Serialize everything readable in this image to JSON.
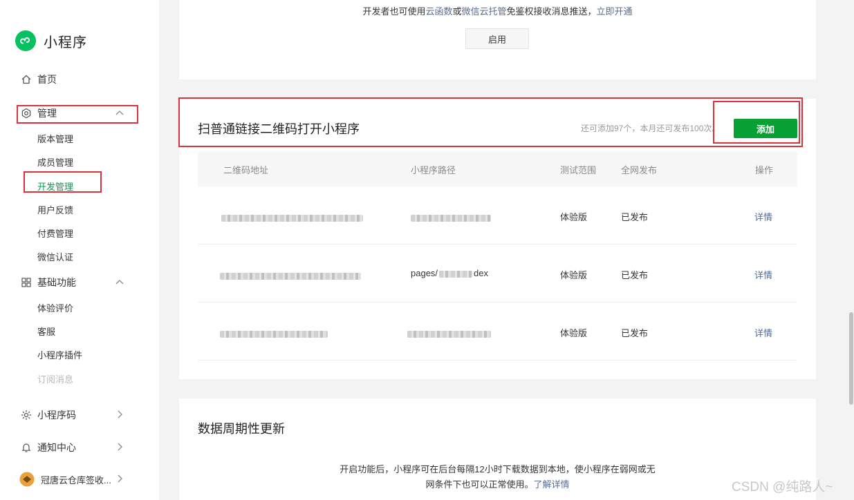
{
  "sidebar": {
    "brand": "小程序",
    "home": "首页",
    "manage": "管理",
    "manage_items": [
      "版本管理",
      "成员管理",
      "开发管理",
      "用户反馈",
      "付费管理",
      "微信认证"
    ],
    "basic": "基础功能",
    "basic_items": [
      "体验评价",
      "客服",
      "小程序插件",
      "订阅消息"
    ],
    "qrcode": "小程序码",
    "notify": "通知中心",
    "account": "冠唐云仓库签收..."
  },
  "top_card": {
    "notice_prefix": "开发者也可使用",
    "notice_link1": "云函数",
    "notice_mid": "或",
    "notice_link2": "微信云托管",
    "notice_suffix": "免鉴权接收消息推送，",
    "notice_link3": "立即开通",
    "enable_button": "启用"
  },
  "qr_card": {
    "title": "扫普通链接二维码打开小程序",
    "quota": "还可添加97个，本月还可发布100次。",
    "add_button": "添加",
    "columns": [
      "二维码地址",
      "小程序路径",
      "测试范围",
      "全网发布",
      "操作"
    ],
    "rows": [
      {
        "range": "体验版",
        "status": "已发布",
        "action": "详情",
        "path_visible": ""
      },
      {
        "range": "体验版",
        "status": "已发布",
        "action": "详情",
        "path_visible": "pages/"
      },
      {
        "range": "体验版",
        "status": "已发布",
        "action": "详情",
        "path_visible": ""
      }
    ],
    "row2_path_tail": "dex"
  },
  "data_card": {
    "title": "数据周期性更新",
    "desc_line1": "开启功能后，小程序可在后台每隔12小时下载数据到本地，使小程序在弱网或无",
    "desc_line2": "网条件下也可以正常使用。",
    "desc_link": "了解详情"
  },
  "watermark": "CSDN @纯路人~",
  "colors": {
    "accent": "#07c160",
    "primary_button": "#07a035",
    "link": "#576b95",
    "highlight": "#d9323b"
  }
}
